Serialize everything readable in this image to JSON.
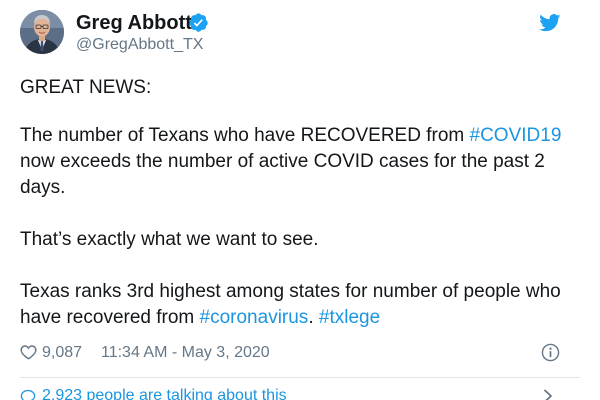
{
  "author": {
    "name": "Greg Abbott",
    "handle": "@GregAbbott_TX",
    "verified": true,
    "avatar_icon": "profile-photo"
  },
  "tweet": {
    "line1": "GREAT NEWS:",
    "line2_pre": "The number of Texans who have RECOVERED from ",
    "line2_hashtag": "#COVID19",
    "line3": "now exceeds the number of active COVID cases for the past 2",
    "line4": "days.",
    "line5": "That’s exactly what we want to see.",
    "line6": "Texas ranks 3rd highest among states for number of people who",
    "line7_pre": "have recovered from ",
    "line7_hashtag1": "#coronavirus",
    "line7_sep": ". ",
    "line7_hashtag2": "#txlege"
  },
  "meta": {
    "likes": "9,087",
    "timestamp": "11:34 AM - May 3, 2020"
  },
  "footer": {
    "talking": "2,923 people are talking about this"
  },
  "colors": {
    "link": "#1b95e0",
    "text": "#14171a",
    "muted": "#657786",
    "verified": "#1da1f2",
    "twitter_logo": "#1da1f2",
    "divider": "#e1e8ed"
  },
  "icons": {
    "verified": "verified-badge-icon",
    "brand": "twitter-bird-icon",
    "like": "heart-icon",
    "info": "info-icon",
    "reply": "speech-bubble-icon",
    "more": "chevron-right-icon"
  }
}
